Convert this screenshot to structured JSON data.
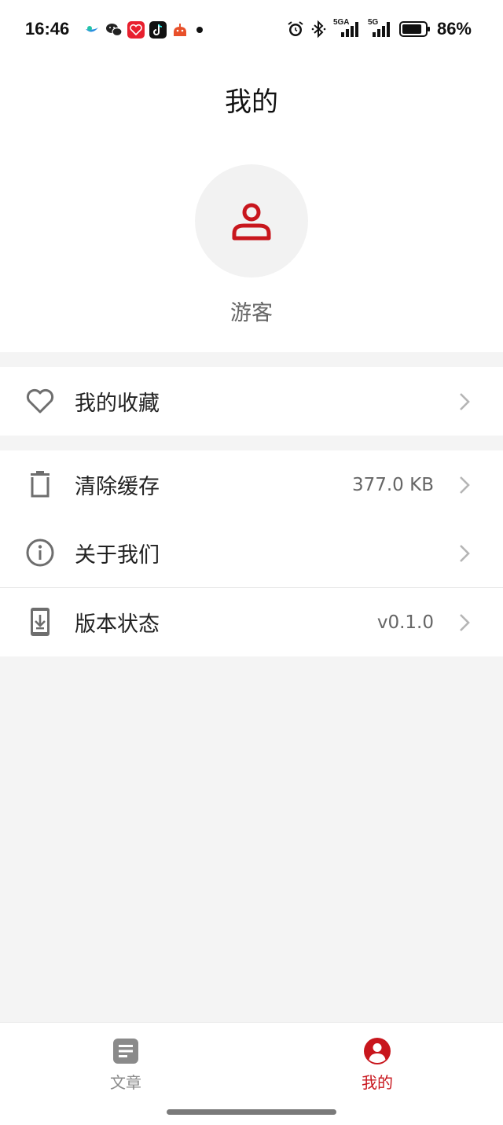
{
  "status_bar": {
    "time": "16:46",
    "notification_icons": [
      "bird-app-icon",
      "wechat-icon",
      "heart-app-icon",
      "tiktok-icon",
      "taobao-icon",
      "more-dot-icon"
    ],
    "system_icons": [
      "alarm-icon",
      "bluetooth-icon",
      "signal-5ga-icon",
      "signal-5g-icon",
      "battery-icon"
    ],
    "signal_labels": [
      "5GA",
      "5G"
    ],
    "battery_percent": "86%",
    "battery_level": 0.86
  },
  "header": {
    "title": "我的",
    "avatar_icon": "user-icon",
    "username": "游客"
  },
  "menu_groups": [
    {
      "items": [
        {
          "label": "我的收藏",
          "icon": "heart-outline-icon",
          "value": ""
        }
      ]
    },
    {
      "items": [
        {
          "label": "清除缓存",
          "icon": "trash-icon",
          "value": "377.0 KB"
        },
        {
          "label": "关于我们",
          "icon": "info-icon",
          "value": ""
        },
        {
          "label": "版本状态",
          "icon": "phone-download-icon",
          "value": "v0.1.0"
        }
      ]
    }
  ],
  "tabbar": {
    "tabs": [
      {
        "label": "文章",
        "icon": "article-icon",
        "active": false
      },
      {
        "label": "我的",
        "icon": "profile-icon",
        "active": true
      }
    ]
  },
  "colors": {
    "accent": "#c8161d",
    "icon_gray": "#6e6e6e",
    "inactive_tab": "#8a8a8a",
    "background": "#f4f4f4"
  }
}
